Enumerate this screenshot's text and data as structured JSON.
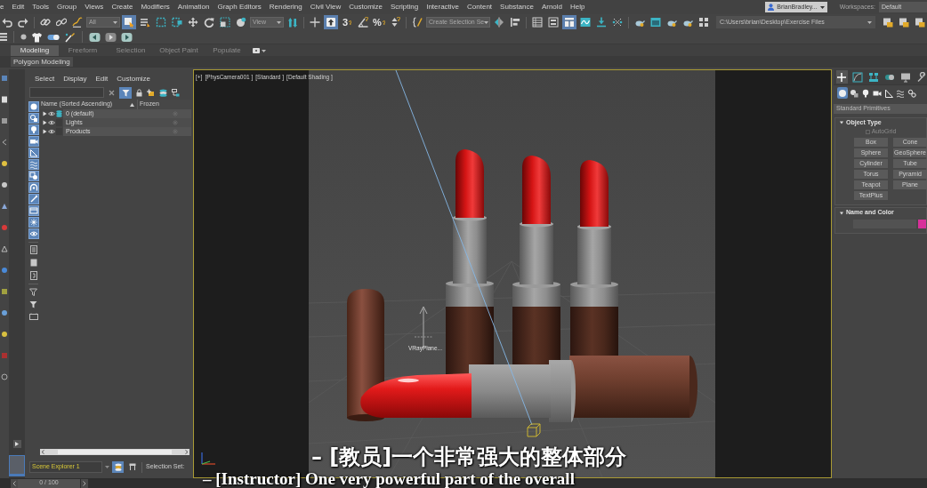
{
  "menu_bar": {
    "items": [
      "e",
      "Edit",
      "Tools",
      "Group",
      "Views",
      "Create",
      "Modifiers",
      "Animation",
      "Graph Editors",
      "Rendering",
      "Civil View",
      "Customize",
      "Scripting",
      "Interactive",
      "Content",
      "Substance",
      "Arnold",
      "Help"
    ],
    "user": "BrianBradley...",
    "workspaces_label": "Workspaces:",
    "workspace": "Default"
  },
  "main_toolbar": {
    "tools": [
      {
        "selected": false
      },
      {
        "selected": false
      },
      {
        "selected": false
      },
      {
        "selected": false
      },
      {
        "selected": false
      },
      {
        "selected": true
      },
      {
        "selected": false
      },
      {
        "selected": false
      },
      {
        "selected": false
      },
      {
        "selected": false
      },
      {
        "selected": false
      },
      {
        "selected": false
      },
      {
        "selected": false
      },
      {
        "selected": false
      },
      {
        "selected": false
      },
      {
        "selected": true
      },
      {
        "label": "3",
        "selected": false
      },
      {
        "selected": false
      },
      {
        "label": "%",
        "selected": false
      },
      {
        "selected": false
      },
      {
        "selected": false
      },
      {
        "selected": false
      },
      {
        "selected": false
      },
      {
        "selected": false
      },
      {
        "selected": false
      },
      {
        "selected": true
      },
      {
        "selected": false
      },
      {
        "selected": false
      },
      {
        "selected": false
      },
      {
        "selected": false
      },
      {
        "selected": false
      },
      {
        "selected": false
      },
      {
        "selected": false
      },
      {
        "selected": false
      },
      {
        "selected": false
      },
      {
        "selected": false
      },
      {
        "selected": false
      }
    ],
    "selection_filter": "All",
    "reference_coordinate": "View",
    "named_selection": "Create Selection Se",
    "project_path": "C:\\Users\\brian\\Desktop\\Exercise Files"
  },
  "ribbon": {
    "tabs": [
      {
        "label": "Modeling",
        "selected": true
      },
      {
        "label": "Freeform",
        "selected": false
      },
      {
        "label": "Selection",
        "selected": false
      },
      {
        "label": "Object Paint",
        "selected": false
      },
      {
        "label": "Populate",
        "selected": false
      }
    ],
    "panel": "Polygon Modeling"
  },
  "scene_explorer": {
    "menu": [
      "Select",
      "Display",
      "Edit",
      "Customize"
    ],
    "filter_toggle": {
      "selected": true
    },
    "type_filters": [
      {
        "selected": true
      },
      {
        "selected": true
      },
      {
        "selected": true
      },
      {
        "selected": true
      },
      {
        "selected": true
      },
      {
        "selected": true
      },
      {
        "selected": true
      },
      {
        "selected": true
      },
      {
        "selected": true
      },
      {
        "selected": true
      },
      {
        "selected": true
      },
      {
        "selected": true
      }
    ],
    "columns": [
      "Name (Sorted Ascending)",
      "Frozen"
    ],
    "rows": [
      {
        "name": "0 (default)",
        "expanded": false,
        "visible": true,
        "current": true
      },
      {
        "name": "Lights",
        "expanded": false,
        "visible": true,
        "current": false
      },
      {
        "name": "Products",
        "expanded": false,
        "visible": true,
        "current": false
      }
    ],
    "explorer_name": "Scene Explorer 1",
    "sort_modes": [
      {
        "selected": true
      },
      {
        "selected": false
      }
    ],
    "selection_set_label": "Selection Set:"
  },
  "viewport": {
    "labels": [
      "[+]",
      "[PhysCamera001 ]",
      "[Standard ]",
      "[Default Shading ]"
    ],
    "helper_label": "VRayPlane..."
  },
  "command_panel": {
    "tabs": [
      {
        "selected": true
      },
      {
        "selected": false
      },
      {
        "selected": false
      },
      {
        "selected": false
      },
      {
        "selected": false
      },
      {
        "selected": false
      }
    ],
    "categories": [
      {
        "selected": true
      },
      {
        "selected": false
      },
      {
        "selected": false
      },
      {
        "selected": false
      },
      {
        "selected": false
      },
      {
        "selected": false
      },
      {
        "selected": false
      }
    ],
    "object_class": "Standard Primitives",
    "object_type": {
      "title": "Object Type",
      "expanded": true,
      "autogrid": {
        "label": "AutoGrid",
        "checked": false,
        "disabled": true
      },
      "buttons": [
        "Box",
        "Cone",
        "Sphere",
        "GeoSphere",
        "Cylinder",
        "Tube",
        "Torus",
        "Pyramid",
        "Teapot",
        "Plane",
        "TextPlus"
      ]
    },
    "name_and_color": {
      "title": "Name and Color",
      "expanded": true,
      "color": "#d8309a"
    }
  },
  "time_slider": {
    "position": "0 / 100"
  },
  "subtitles": [
    "– [教员]一个非常强大的整体部分",
    "– [Instructor] One very powerful part of the overall"
  ]
}
